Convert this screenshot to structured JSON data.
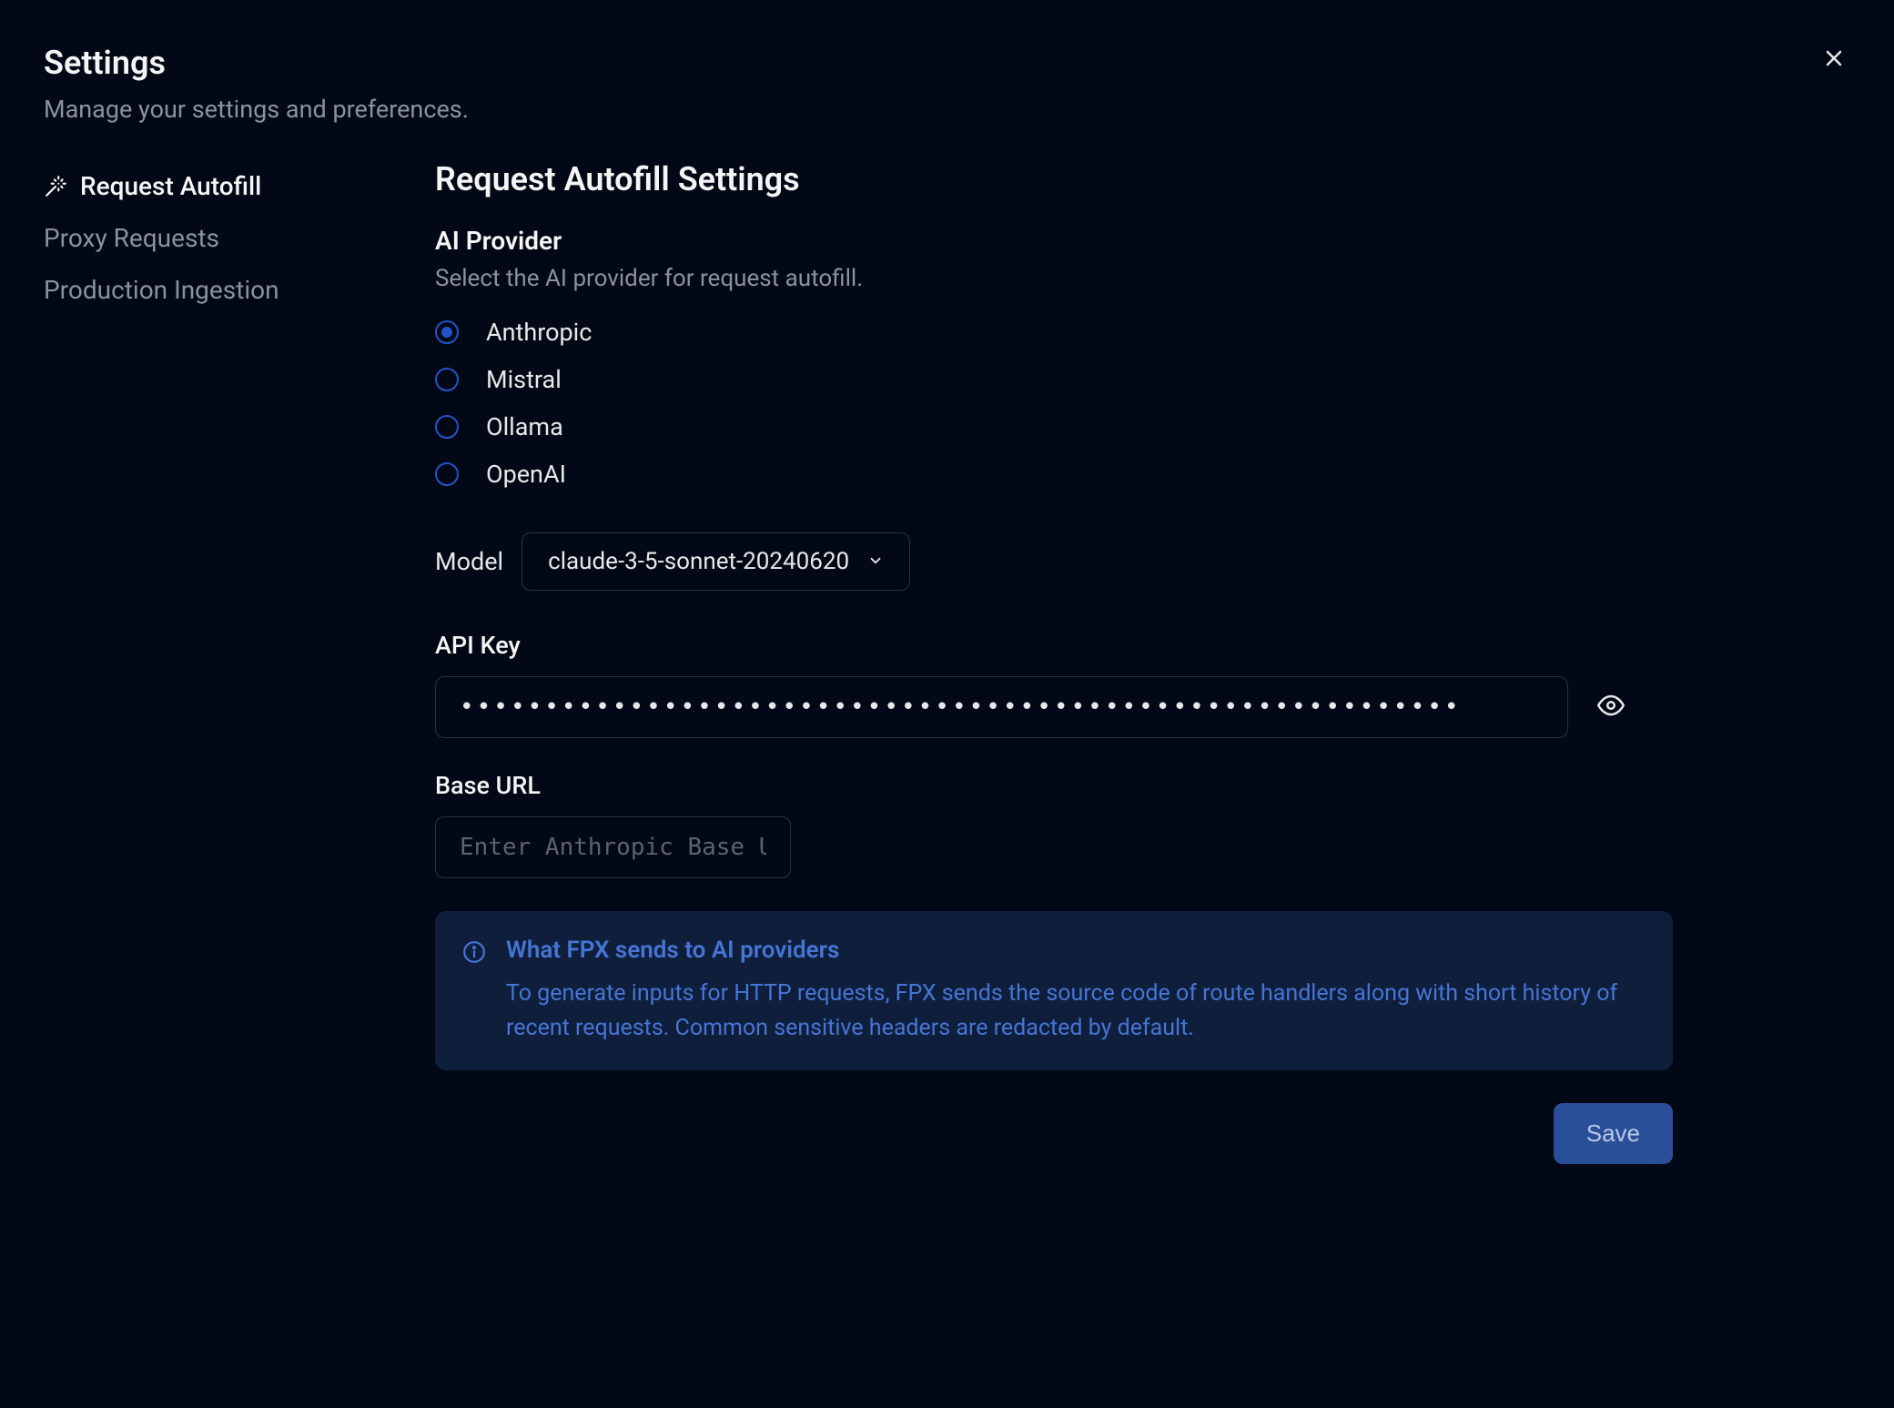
{
  "header": {
    "title": "Settings",
    "subtitle": "Manage your settings and preferences."
  },
  "sidebar": {
    "items": [
      {
        "label": "Request Autofill",
        "active": true
      },
      {
        "label": "Proxy Requests",
        "active": false
      },
      {
        "label": "Production Ingestion",
        "active": false
      }
    ]
  },
  "main": {
    "title": "Request Autofill Settings",
    "provider_section": {
      "title": "AI Provider",
      "description": "Select the AI provider for request autofill.",
      "options": [
        {
          "label": "Anthropic",
          "selected": true
        },
        {
          "label": "Mistral",
          "selected": false
        },
        {
          "label": "Ollama",
          "selected": false
        },
        {
          "label": "OpenAI",
          "selected": false
        }
      ]
    },
    "model": {
      "label": "Model",
      "value": "claude-3-5-sonnet-20240620"
    },
    "api_key": {
      "label": "API Key",
      "value": "●●●●●●●●●●●●●●●●●●●●●●●●●●●●●●●●●●●●●●●●●●●●●●●●●●●●●●●●●●●"
    },
    "base_url": {
      "label": "Base URL",
      "placeholder": "Enter Anthropic Base URL",
      "value": ""
    },
    "info": {
      "title": "What FPX sends to AI providers",
      "text": "To generate inputs for HTTP requests, FPX sends the source code of route handlers along with short history of recent requests. Common sensitive headers are redacted by default."
    },
    "save_label": "Save"
  }
}
